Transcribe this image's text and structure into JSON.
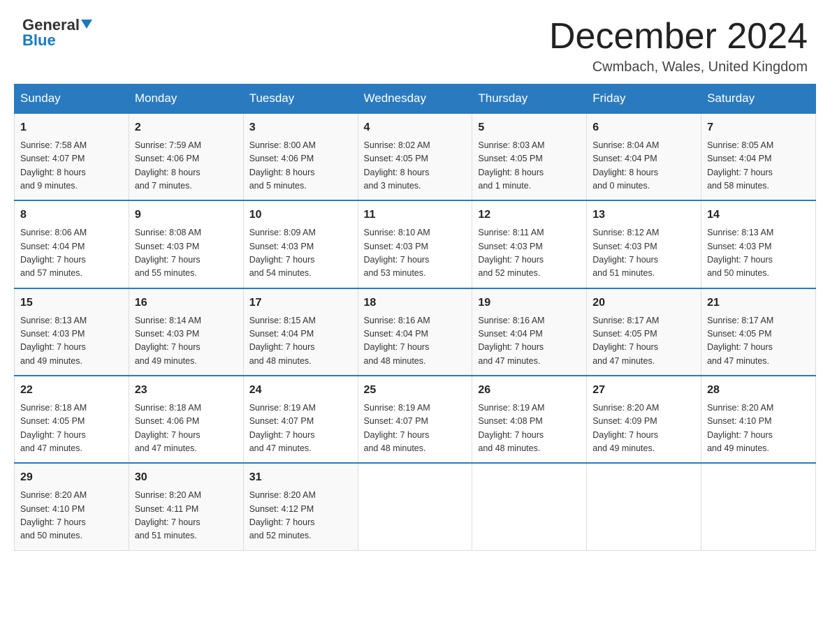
{
  "header": {
    "logo_general": "General",
    "logo_blue": "Blue",
    "month_title": "December 2024",
    "location": "Cwmbach, Wales, United Kingdom"
  },
  "days_of_week": [
    "Sunday",
    "Monday",
    "Tuesday",
    "Wednesday",
    "Thursday",
    "Friday",
    "Saturday"
  ],
  "weeks": [
    [
      {
        "day": "1",
        "info": "Sunrise: 7:58 AM\nSunset: 4:07 PM\nDaylight: 8 hours\nand 9 minutes."
      },
      {
        "day": "2",
        "info": "Sunrise: 7:59 AM\nSunset: 4:06 PM\nDaylight: 8 hours\nand 7 minutes."
      },
      {
        "day": "3",
        "info": "Sunrise: 8:00 AM\nSunset: 4:06 PM\nDaylight: 8 hours\nand 5 minutes."
      },
      {
        "day": "4",
        "info": "Sunrise: 8:02 AM\nSunset: 4:05 PM\nDaylight: 8 hours\nand 3 minutes."
      },
      {
        "day": "5",
        "info": "Sunrise: 8:03 AM\nSunset: 4:05 PM\nDaylight: 8 hours\nand 1 minute."
      },
      {
        "day": "6",
        "info": "Sunrise: 8:04 AM\nSunset: 4:04 PM\nDaylight: 8 hours\nand 0 minutes."
      },
      {
        "day": "7",
        "info": "Sunrise: 8:05 AM\nSunset: 4:04 PM\nDaylight: 7 hours\nand 58 minutes."
      }
    ],
    [
      {
        "day": "8",
        "info": "Sunrise: 8:06 AM\nSunset: 4:04 PM\nDaylight: 7 hours\nand 57 minutes."
      },
      {
        "day": "9",
        "info": "Sunrise: 8:08 AM\nSunset: 4:03 PM\nDaylight: 7 hours\nand 55 minutes."
      },
      {
        "day": "10",
        "info": "Sunrise: 8:09 AM\nSunset: 4:03 PM\nDaylight: 7 hours\nand 54 minutes."
      },
      {
        "day": "11",
        "info": "Sunrise: 8:10 AM\nSunset: 4:03 PM\nDaylight: 7 hours\nand 53 minutes."
      },
      {
        "day": "12",
        "info": "Sunrise: 8:11 AM\nSunset: 4:03 PM\nDaylight: 7 hours\nand 52 minutes."
      },
      {
        "day": "13",
        "info": "Sunrise: 8:12 AM\nSunset: 4:03 PM\nDaylight: 7 hours\nand 51 minutes."
      },
      {
        "day": "14",
        "info": "Sunrise: 8:13 AM\nSunset: 4:03 PM\nDaylight: 7 hours\nand 50 minutes."
      }
    ],
    [
      {
        "day": "15",
        "info": "Sunrise: 8:13 AM\nSunset: 4:03 PM\nDaylight: 7 hours\nand 49 minutes."
      },
      {
        "day": "16",
        "info": "Sunrise: 8:14 AM\nSunset: 4:03 PM\nDaylight: 7 hours\nand 49 minutes."
      },
      {
        "day": "17",
        "info": "Sunrise: 8:15 AM\nSunset: 4:04 PM\nDaylight: 7 hours\nand 48 minutes."
      },
      {
        "day": "18",
        "info": "Sunrise: 8:16 AM\nSunset: 4:04 PM\nDaylight: 7 hours\nand 48 minutes."
      },
      {
        "day": "19",
        "info": "Sunrise: 8:16 AM\nSunset: 4:04 PM\nDaylight: 7 hours\nand 47 minutes."
      },
      {
        "day": "20",
        "info": "Sunrise: 8:17 AM\nSunset: 4:05 PM\nDaylight: 7 hours\nand 47 minutes."
      },
      {
        "day": "21",
        "info": "Sunrise: 8:17 AM\nSunset: 4:05 PM\nDaylight: 7 hours\nand 47 minutes."
      }
    ],
    [
      {
        "day": "22",
        "info": "Sunrise: 8:18 AM\nSunset: 4:05 PM\nDaylight: 7 hours\nand 47 minutes."
      },
      {
        "day": "23",
        "info": "Sunrise: 8:18 AM\nSunset: 4:06 PM\nDaylight: 7 hours\nand 47 minutes."
      },
      {
        "day": "24",
        "info": "Sunrise: 8:19 AM\nSunset: 4:07 PM\nDaylight: 7 hours\nand 47 minutes."
      },
      {
        "day": "25",
        "info": "Sunrise: 8:19 AM\nSunset: 4:07 PM\nDaylight: 7 hours\nand 48 minutes."
      },
      {
        "day": "26",
        "info": "Sunrise: 8:19 AM\nSunset: 4:08 PM\nDaylight: 7 hours\nand 48 minutes."
      },
      {
        "day": "27",
        "info": "Sunrise: 8:20 AM\nSunset: 4:09 PM\nDaylight: 7 hours\nand 49 minutes."
      },
      {
        "day": "28",
        "info": "Sunrise: 8:20 AM\nSunset: 4:10 PM\nDaylight: 7 hours\nand 49 minutes."
      }
    ],
    [
      {
        "day": "29",
        "info": "Sunrise: 8:20 AM\nSunset: 4:10 PM\nDaylight: 7 hours\nand 50 minutes."
      },
      {
        "day": "30",
        "info": "Sunrise: 8:20 AM\nSunset: 4:11 PM\nDaylight: 7 hours\nand 51 minutes."
      },
      {
        "day": "31",
        "info": "Sunrise: 8:20 AM\nSunset: 4:12 PM\nDaylight: 7 hours\nand 52 minutes."
      },
      {
        "day": "",
        "info": ""
      },
      {
        "day": "",
        "info": ""
      },
      {
        "day": "",
        "info": ""
      },
      {
        "day": "",
        "info": ""
      }
    ]
  ]
}
